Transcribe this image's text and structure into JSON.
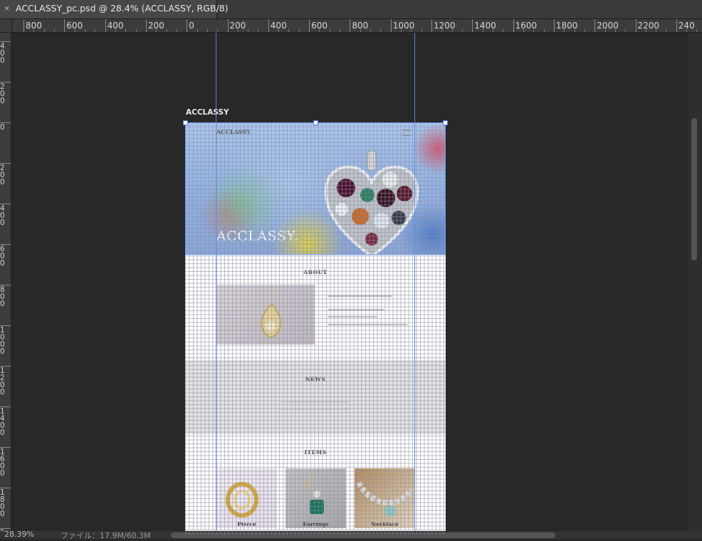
{
  "tab": {
    "title": "ACCLASSY_pc.psd @ 28.4% (ACCLASSY, RGB/8)",
    "close_glyph": "×"
  },
  "ruler_h_labels": [
    "800",
    "600",
    "400",
    "200",
    "0",
    "200",
    "400",
    "600",
    "800",
    "1000",
    "1200",
    "1400",
    "1600",
    "1800",
    "2000",
    "2200",
    "240"
  ],
  "ruler_v_labels": [
    "4\n0\n0",
    "2\n0\n0",
    "0",
    "2\n0\n0",
    "4\n0\n0",
    "6\n0\n0",
    "8\n0\n0",
    "1\n0\n0\n0",
    "1\n2\n0\n0",
    "1\n4\n0\n0",
    "1\n6\n0\n0",
    "1\n8\n0\n0",
    "2"
  ],
  "artboard": {
    "name": "ACCLASSY"
  },
  "site": {
    "nav_logo": "ACCLASSY",
    "hero_title": "ACCLASSY.",
    "about_heading": "ABOUT",
    "news_heading": "NEWS",
    "items_heading": "ITEMS",
    "items": [
      {
        "label": "Pierce"
      },
      {
        "label": "Earrings"
      },
      {
        "label": "Necklace"
      }
    ]
  },
  "status": {
    "zoom": "28.39%",
    "doc": "ファイル：17.9M/60.3M"
  },
  "colors": {
    "workspace": "#282828",
    "guide": "#5b8ce8",
    "ruler": "#3c3c3c"
  }
}
